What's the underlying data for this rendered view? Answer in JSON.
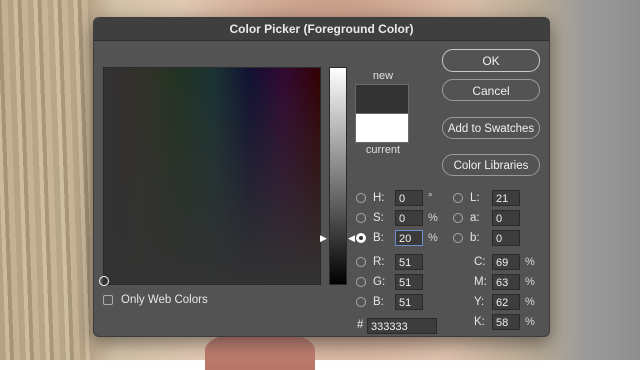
{
  "dialog": {
    "title": "Color Picker (Foreground Color)",
    "ok_label": "OK",
    "cancel_label": "Cancel",
    "swatches_label": "Add to Swatches",
    "libraries_label": "Color Libraries",
    "new_label": "new",
    "current_label": "current",
    "new_color": "#333333",
    "current_color": "#ffffff",
    "only_web_colors_label": "Only Web Colors",
    "hex_prefix": "#",
    "hex_value": "333333"
  },
  "hsb": [
    {
      "label": "H:",
      "value": "0",
      "unit": "°"
    },
    {
      "label": "S:",
      "value": "0",
      "unit": "%"
    },
    {
      "label": "B:",
      "value": "20",
      "unit": "%"
    }
  ],
  "rgb": [
    {
      "label": "R:",
      "value": "51"
    },
    {
      "label": "G:",
      "value": "51"
    },
    {
      "label": "B:",
      "value": "51"
    }
  ],
  "lab": [
    {
      "label": "L:",
      "value": "21"
    },
    {
      "label": "a:",
      "value": "0"
    },
    {
      "label": "b:",
      "value": "0"
    }
  ],
  "cmyk": [
    {
      "label": "C:",
      "value": "69",
      "unit": "%"
    },
    {
      "label": "M:",
      "value": "63",
      "unit": "%"
    },
    {
      "label": "Y:",
      "value": "62",
      "unit": "%"
    },
    {
      "label": "K:",
      "value": "58",
      "unit": "%"
    }
  ]
}
